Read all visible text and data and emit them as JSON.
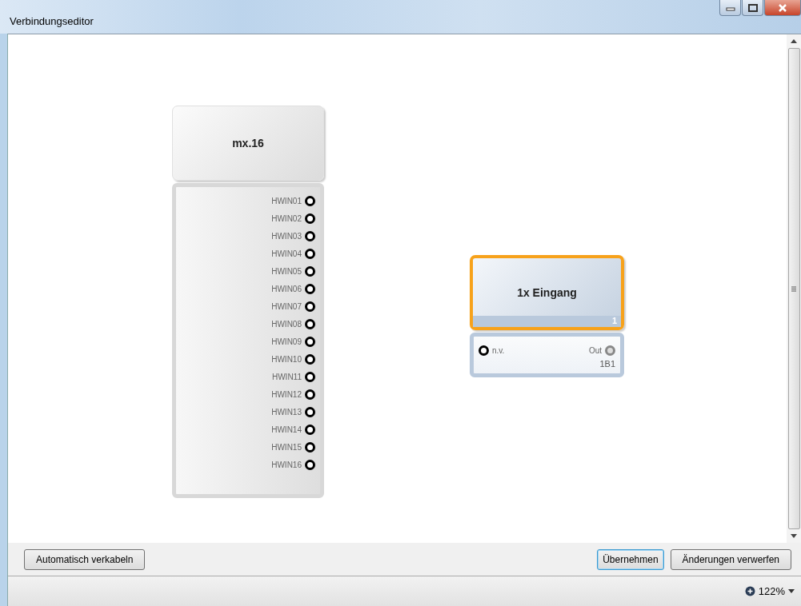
{
  "window": {
    "title": "Verbindungseditor"
  },
  "nodes": [
    {
      "title": "mx.16",
      "selected": false,
      "ports": [
        {
          "label": "HWIN01",
          "kind": "out",
          "enabled": true
        },
        {
          "label": "HWIN02",
          "kind": "out",
          "enabled": true
        },
        {
          "label": "HWIN03",
          "kind": "out",
          "enabled": true
        },
        {
          "label": "HWIN04",
          "kind": "out",
          "enabled": true
        },
        {
          "label": "HWIN05",
          "kind": "out",
          "enabled": true
        },
        {
          "label": "HWIN06",
          "kind": "out",
          "enabled": true
        },
        {
          "label": "HWIN07",
          "kind": "out",
          "enabled": true
        },
        {
          "label": "HWIN08",
          "kind": "out",
          "enabled": true
        },
        {
          "label": "HWIN09",
          "kind": "out",
          "enabled": true
        },
        {
          "label": "HWIN10",
          "kind": "out",
          "enabled": true
        },
        {
          "label": "HWIN11",
          "kind": "out",
          "enabled": true
        },
        {
          "label": "HWIN12",
          "kind": "out",
          "enabled": true
        },
        {
          "label": "HWIN13",
          "kind": "out",
          "enabled": true
        },
        {
          "label": "HWIN14",
          "kind": "out",
          "enabled": true
        },
        {
          "label": "HWIN15",
          "kind": "out",
          "enabled": true
        },
        {
          "label": "HWIN16",
          "kind": "out",
          "enabled": true
        }
      ]
    },
    {
      "title": "1x Eingang",
      "selected": true,
      "badge": "1",
      "ports": [
        {
          "label": "n.v.",
          "kind": "in",
          "enabled": true
        },
        {
          "label": "Out",
          "kind": "out",
          "enabled": false,
          "sublabel": "1B1"
        }
      ]
    }
  ],
  "buttons": {
    "left": [
      "Automatisch verkabeln"
    ],
    "right": [
      {
        "label": "Übernehmen",
        "focused": true
      },
      {
        "label": "Änderungen verwerfen",
        "focused": false
      }
    ]
  },
  "status_bar": {
    "zoom": "122%"
  }
}
